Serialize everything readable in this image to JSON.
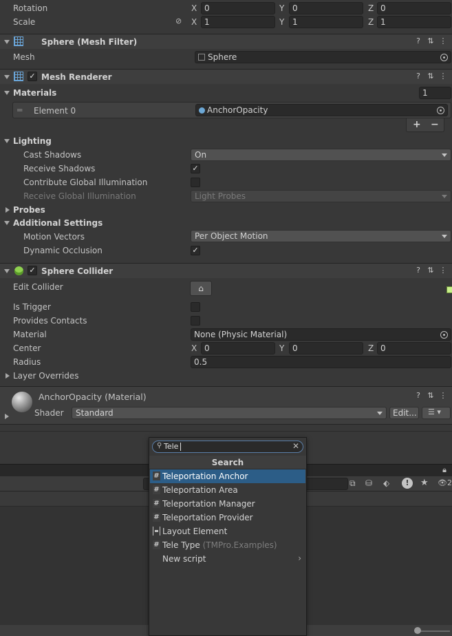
{
  "transform": {
    "rotation_label": "Rotation",
    "scale_label": "Scale",
    "rotation": {
      "x": "0",
      "y": "0",
      "z": "0"
    },
    "scale": {
      "x": "1",
      "y": "1",
      "z": "1"
    },
    "axis_x": "X",
    "axis_y": "Y",
    "axis_z": "Z"
  },
  "mesh_filter": {
    "title": "Sphere (Mesh Filter)",
    "mesh_label": "Mesh",
    "mesh_value": "Sphere"
  },
  "mesh_renderer": {
    "title": "Mesh Renderer",
    "materials_label": "Materials",
    "materials_count": "1",
    "element_label": "Element 0",
    "element_value": "AnchorOpacity",
    "add_label": "+",
    "remove_label": "−",
    "lighting_label": "Lighting",
    "cast_shadows_label": "Cast Shadows",
    "cast_shadows_value": "On",
    "receive_shadows_label": "Receive Shadows",
    "contribute_gi_label": "Contribute Global Illumination",
    "receive_gi_label": "Receive Global Illumination",
    "receive_gi_value": "Light Probes",
    "probes_label": "Probes",
    "additional_label": "Additional Settings",
    "motion_vectors_label": "Motion Vectors",
    "motion_vectors_value": "Per Object Motion",
    "dynamic_occlusion_label": "Dynamic Occlusion"
  },
  "sphere_collider": {
    "title": "Sphere Collider",
    "edit_collider_label": "Edit Collider",
    "is_trigger_label": "Is Trigger",
    "provides_contacts_label": "Provides Contacts",
    "material_label": "Material",
    "material_value": "None (Physic Material)",
    "center_label": "Center",
    "center": {
      "x": "0",
      "y": "0",
      "z": "0"
    },
    "radius_label": "Radius",
    "radius_value": "0.5",
    "layer_overrides_label": "Layer Overrides"
  },
  "material": {
    "title": "AnchorOpacity (Material)",
    "shader_label": "Shader",
    "shader_value": "Standard",
    "edit_label": "Edit..."
  },
  "add_component": {
    "search_value": "Tele",
    "header": "Search",
    "items": [
      {
        "label": "Teleportation Anchor",
        "icon": "#",
        "suffix": ""
      },
      {
        "label": "Teleportation Area",
        "icon": "#",
        "suffix": ""
      },
      {
        "label": "Teleportation Manager",
        "icon": "#",
        "suffix": ""
      },
      {
        "label": "Teleportation Provider",
        "icon": "#",
        "suffix": ""
      },
      {
        "label": "Layout Element",
        "icon": "layout",
        "suffix": ""
      },
      {
        "label": "Tele Type",
        "icon": "#",
        "suffix": "(TMPro.Examples)"
      },
      {
        "label": "New script",
        "icon": "",
        "suffix": ""
      }
    ]
  },
  "colors": {
    "panel": "#383838",
    "header": "#3e3e3e",
    "field": "#2a2a2a",
    "selection": "#2c5d87",
    "menu": "#383838"
  }
}
